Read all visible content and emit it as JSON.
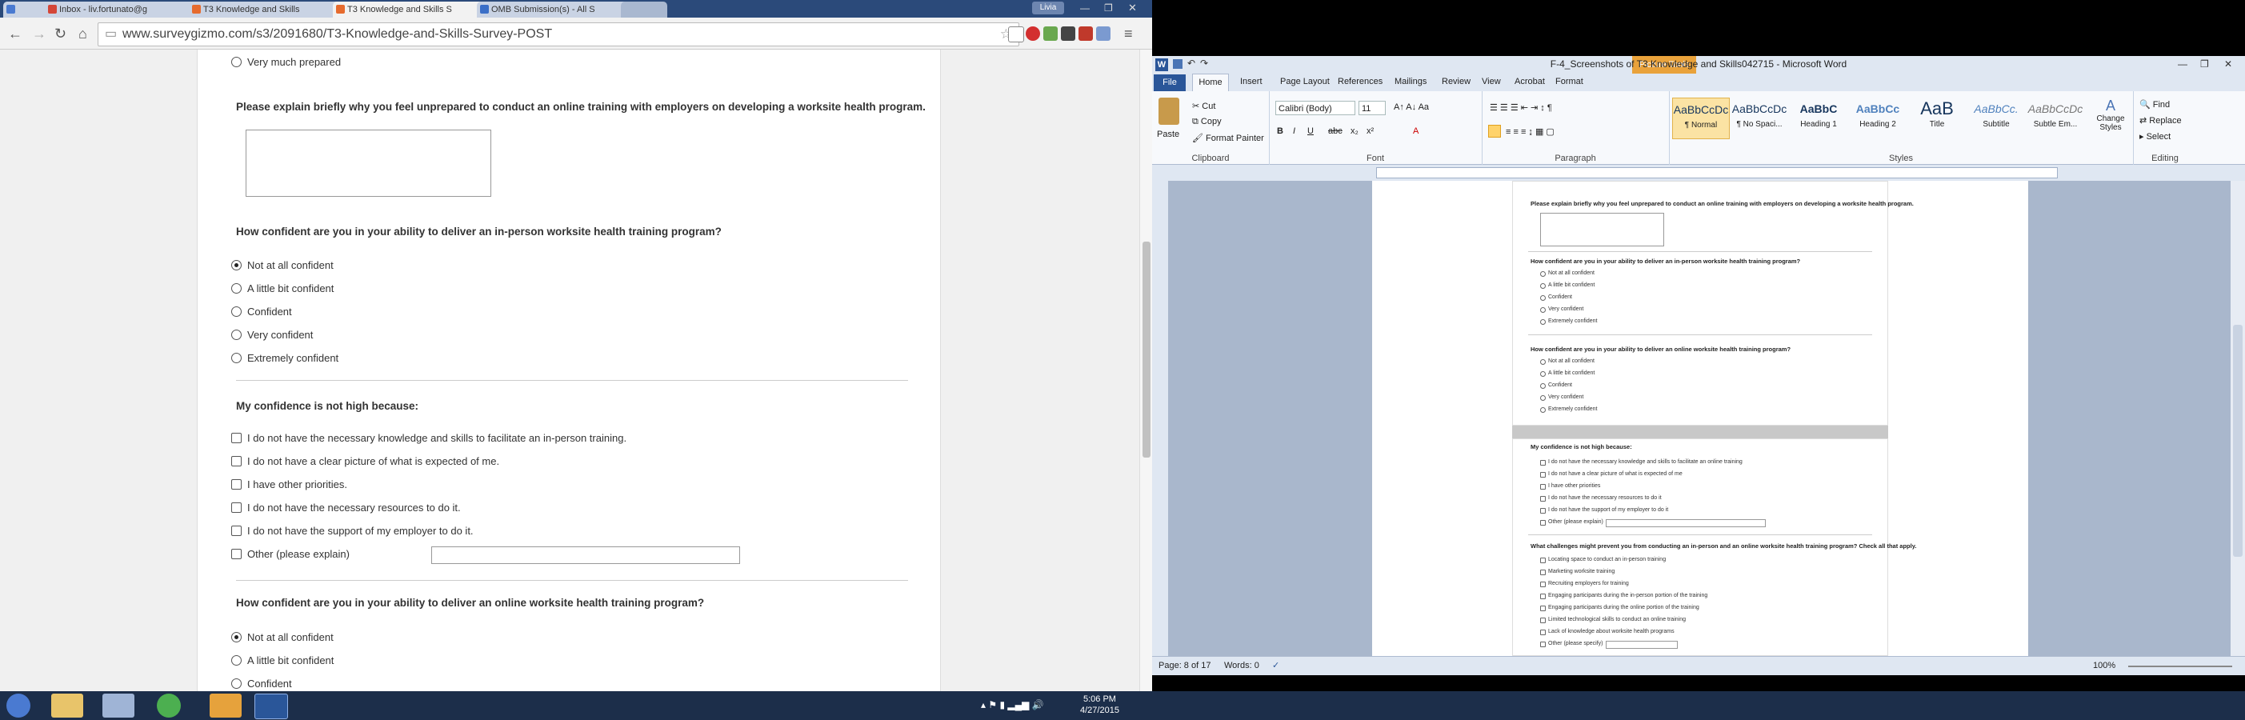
{
  "browser": {
    "tabs": [
      {
        "title": "Inbox - liv.fortunato@g",
        "color": "#d44638"
      },
      {
        "title": "T3 Knowledge and Skills",
        "color": "#e66b2e"
      },
      {
        "title": "T3 Knowledge and Skills S",
        "color": "#e66b2e"
      },
      {
        "title": "OMB Submission(s) - All S",
        "color": "#3b6fc7"
      }
    ],
    "user_badge": "Livia",
    "url": "www.surveygizmo.com/s3/2091680/T3-Knowledge-and-Skills-Survey-POST",
    "icons": {
      "back": "back-icon",
      "forward": "forward-icon",
      "reload": "reload-icon",
      "home": "home-icon",
      "star": "star-icon",
      "menu": "menu-icon"
    }
  },
  "survey": {
    "prev_option": "Very much prepared",
    "q_unprepared": "Please explain briefly why you feel unprepared to conduct an online training with employers on developing a worksite health program.",
    "q_inperson": "How confident are you in your ability to deliver an in-person worksite health training program?",
    "inperson_options": [
      "Not at all confident",
      "A little bit confident",
      "Confident",
      "Very confident",
      "Extremely confident"
    ],
    "inperson_selected": 0,
    "q_not_high": "My confidence is not high because:",
    "not_high_options": [
      "I do not have the necessary knowledge and skills to facilitate an in-person training.",
      "I do not have a clear picture of what is expected of me.",
      "I have other priorities.",
      "I do not have the necessary resources to do it.",
      "I do not have the support of my employer to do it.",
      "Other (please explain)"
    ],
    "q_online": "How confident are you in your ability to deliver an online worksite health training program?",
    "online_options": [
      "Not at all confident",
      "A little bit confident",
      "Confident"
    ],
    "online_selected": 0
  },
  "word": {
    "title": "F-4_Screenshots of T3 Knowledge and Skills042715  -  Microsoft Word",
    "contextual_tab": "Picture Tools",
    "tabs": [
      "Home",
      "Insert",
      "Page Layout",
      "References",
      "Mailings",
      "Review",
      "View",
      "Acrobat",
      "Format"
    ],
    "file_tab": "File",
    "clipboard": {
      "paste": "Paste",
      "cut": "Cut",
      "copy": "Copy",
      "format_painter": "Format Painter",
      "label": "Clipboard"
    },
    "font": {
      "name": "Calibri (Body)",
      "size": "11",
      "label": "Font"
    },
    "paragraph_label": "Paragraph",
    "styles": [
      {
        "sample": "AaBbCcDc",
        "name": "¶ Normal"
      },
      {
        "sample": "AaBbCcDc",
        "name": "¶ No Spaci..."
      },
      {
        "sample": "AaBbC",
        "name": "Heading 1"
      },
      {
        "sample": "AaBbCc",
        "name": "Heading 2"
      },
      {
        "sample": "AaB",
        "name": "Title"
      },
      {
        "sample": "AaBbCc.",
        "name": "Subtitle"
      },
      {
        "sample": "AaBbCcDc",
        "name": "Subtle Em..."
      }
    ],
    "styles_label": "Styles",
    "change_styles": "Change Styles",
    "editing": {
      "find": "Find",
      "replace": "Replace",
      "select": "Select",
      "label": "Editing"
    },
    "status": {
      "page": "Page: 8 of 17",
      "words": "Words: 0",
      "zoom": "100%"
    },
    "doc": {
      "q1": "Please explain briefly why you feel unprepared to conduct an online training with employers on developing a worksite health program.",
      "q2": "How confident are you in your ability to deliver an in-person worksite health training program?",
      "q3": "How confident are you in your ability to deliver an online worksite health training program?",
      "conf_opts": [
        "Not at all confident",
        "A little bit confident",
        "Confident",
        "Very confident",
        "Extremely confident"
      ],
      "q4": "My confidence is not high because:",
      "q4_opts": [
        "I do not have the necessary knowledge and skills to facilitate an online training",
        "I do not have a clear picture of what is expected of me",
        "I have other priorities",
        "I do not have the necessary resources to do it",
        "I do not have the support of my employer to do it",
        "Other (please explain)"
      ],
      "q5": "What challenges might prevent you from conducting an in-person and an online worksite health training program? Check all that apply.",
      "q5_opts": [
        "Locating space to conduct an in-person training",
        "Marketing worksite training",
        "Recruiting employers for training",
        "Engaging participants during the in-person portion of the training",
        "Engaging participants during the online portion of the training",
        "Limited technological skills to conduct an online training",
        "Lack of knowledge about worksite health programs",
        "Other (please specify)"
      ]
    }
  },
  "taskbar": {
    "time": "5:06 PM",
    "date": "4/27/2015"
  }
}
